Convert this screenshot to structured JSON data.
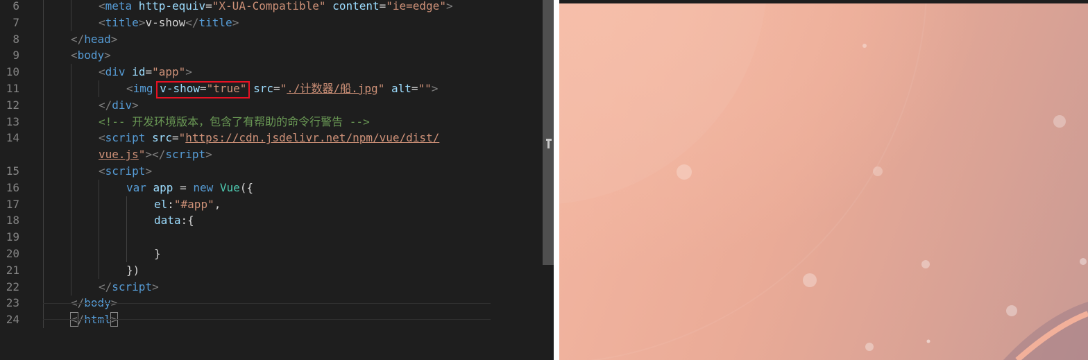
{
  "editor": {
    "lines": [
      {
        "n": "6",
        "tokens": [
          {
            "c": "t",
            "v": "<"
          },
          {
            "c": "tag",
            "v": "meta"
          },
          {
            "c": "attr",
            "v": " http-equiv"
          },
          {
            "c": "txt",
            "v": "="
          },
          {
            "c": "str",
            "v": "\"X-UA-Compatible\""
          },
          {
            "c": "attr",
            "v": " content"
          },
          {
            "c": "txt",
            "v": "="
          },
          {
            "c": "str",
            "v": "\"ie=edge\""
          },
          {
            "c": "t",
            "v": ">"
          }
        ]
      },
      {
        "n": "7",
        "tokens": [
          {
            "c": "t",
            "v": "<"
          },
          {
            "c": "tag",
            "v": "title"
          },
          {
            "c": "t",
            "v": ">"
          },
          {
            "c": "txt",
            "v": "v-show"
          },
          {
            "c": "t",
            "v": "</"
          },
          {
            "c": "tag",
            "v": "title"
          },
          {
            "c": "t",
            "v": ">"
          }
        ]
      },
      {
        "n": "8",
        "tokens": [
          {
            "c": "t",
            "v": "</"
          },
          {
            "c": "tag",
            "v": "head"
          },
          {
            "c": "t",
            "v": ">"
          }
        ]
      },
      {
        "n": "9",
        "tokens": [
          {
            "c": "t",
            "v": "<"
          },
          {
            "c": "tag",
            "v": "body"
          },
          {
            "c": "t",
            "v": ">"
          }
        ]
      },
      {
        "n": "10",
        "tokens": [
          {
            "c": "t",
            "v": "<"
          },
          {
            "c": "tag",
            "v": "div"
          },
          {
            "c": "attr",
            "v": " id"
          },
          {
            "c": "txt",
            "v": "="
          },
          {
            "c": "str",
            "v": "\"app\""
          },
          {
            "c": "t",
            "v": ">"
          }
        ]
      },
      {
        "n": "11",
        "tokens": [
          {
            "c": "t",
            "v": "<"
          },
          {
            "c": "tag",
            "v": "img"
          },
          {
            "c": "txt",
            "v": " "
          },
          {
            "c": "attr hl-a",
            "v": "v-show"
          },
          {
            "c": "txt hl-b",
            "v": "="
          },
          {
            "c": "str hl-c",
            "v": "\"true\""
          },
          {
            "c": "txt",
            "v": " "
          },
          {
            "c": "attr",
            "v": "src"
          },
          {
            "c": "txt",
            "v": "="
          },
          {
            "c": "str",
            "v": "\""
          },
          {
            "c": "str link",
            "v": "./计数器/船.jpg"
          },
          {
            "c": "str",
            "v": "\""
          },
          {
            "c": "attr",
            "v": " alt"
          },
          {
            "c": "txt",
            "v": "="
          },
          {
            "c": "str",
            "v": "\"\""
          },
          {
            "c": "t",
            "v": ">"
          }
        ]
      },
      {
        "n": "12",
        "tokens": [
          {
            "c": "t",
            "v": "</"
          },
          {
            "c": "tag",
            "v": "div"
          },
          {
            "c": "t",
            "v": ">"
          }
        ]
      },
      {
        "n": "13",
        "tokens": [
          {
            "c": "cm",
            "v": "<!-- 开发环境版本，包含了有帮助的命令行警告 -->"
          }
        ]
      },
      {
        "n": "14",
        "tokens": [
          {
            "c": "t",
            "v": "<"
          },
          {
            "c": "tag",
            "v": "script"
          },
          {
            "c": "attr",
            "v": " src"
          },
          {
            "c": "txt",
            "v": "="
          },
          {
            "c": "str",
            "v": "\""
          },
          {
            "c": "str link",
            "v": "https://cdn.jsdelivr.net/npm/vue/dist/"
          }
        ]
      },
      {
        "n": "",
        "tokens": [
          {
            "c": "str link",
            "v": "vue.js"
          },
          {
            "c": "str",
            "v": "\""
          },
          {
            "c": "t",
            "v": "></"
          },
          {
            "c": "tag",
            "v": "script"
          },
          {
            "c": "t",
            "v": ">"
          }
        ]
      },
      {
        "n": "15",
        "tokens": [
          {
            "c": "t",
            "v": "<"
          },
          {
            "c": "tag",
            "v": "script"
          },
          {
            "c": "t",
            "v": ">"
          }
        ]
      },
      {
        "n": "16",
        "tokens": [
          {
            "c": "kw",
            "v": "var"
          },
          {
            "c": "attr",
            "v": " app"
          },
          {
            "c": "txt",
            "v": " = "
          },
          {
            "c": "kw",
            "v": "new"
          },
          {
            "c": "txt",
            "v": " "
          },
          {
            "c": "cls",
            "v": "Vue"
          },
          {
            "c": "txt",
            "v": "({"
          }
        ]
      },
      {
        "n": "17",
        "tokens": [
          {
            "c": "attr",
            "v": "el"
          },
          {
            "c": "txt",
            "v": ":"
          },
          {
            "c": "str",
            "v": "\"#app\""
          },
          {
            "c": "txt",
            "v": ","
          }
        ]
      },
      {
        "n": "18",
        "tokens": [
          {
            "c": "attr",
            "v": "data"
          },
          {
            "c": "txt",
            "v": ":{"
          }
        ]
      },
      {
        "n": "19",
        "tokens": []
      },
      {
        "n": "20",
        "tokens": [
          {
            "c": "txt",
            "v": "}"
          }
        ]
      },
      {
        "n": "21",
        "tokens": [
          {
            "c": "txt",
            "v": "})"
          }
        ]
      },
      {
        "n": "22",
        "tokens": [
          {
            "c": "t",
            "v": "</"
          },
          {
            "c": "tag",
            "v": "script"
          },
          {
            "c": "t",
            "v": ">"
          }
        ]
      },
      {
        "n": "23",
        "tokens": [
          {
            "c": "t",
            "v": "</"
          },
          {
            "c": "tag",
            "v": "body"
          },
          {
            "c": "t",
            "v": ">"
          }
        ]
      },
      {
        "n": "24",
        "tokens": [
          {
            "c": "t cursor-bracket",
            "v": "<"
          },
          {
            "c": "t",
            "v": "/"
          },
          {
            "c": "tag",
            "v": "html"
          },
          {
            "c": "t cursor-bracket",
            "v": ">"
          }
        ]
      }
    ]
  },
  "colors": {
    "highlight_box": "#e81123",
    "preview_peach": "#f4b7a2",
    "preview_mauve": "#c99a94"
  }
}
